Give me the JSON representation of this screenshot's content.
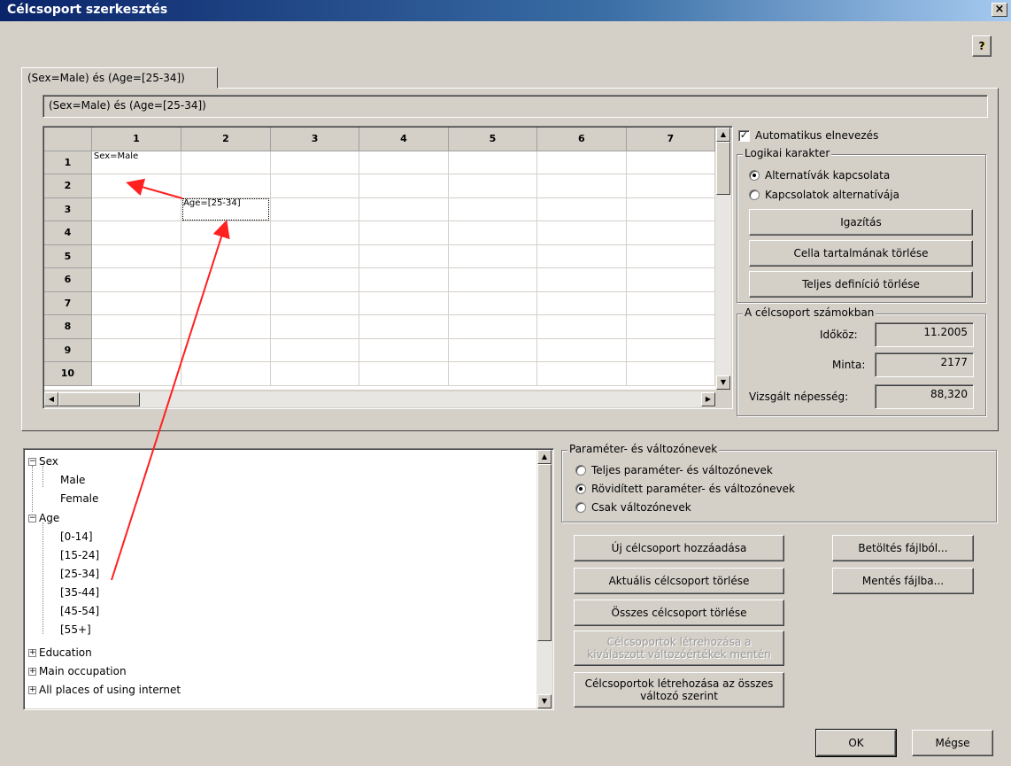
{
  "window": {
    "title": "Célcsoport szerkesztés",
    "close": "×",
    "help": "?"
  },
  "tab": {
    "label": "(Sex=Male) és (Age=[25-34])"
  },
  "expression": "(Sex=Male) és (Age=[25-34])",
  "grid": {
    "columns": [
      "1",
      "2",
      "3",
      "4",
      "5",
      "6",
      "7"
    ],
    "rows": [
      "1",
      "2",
      "3",
      "4",
      "5",
      "6",
      "7",
      "8",
      "9",
      "10"
    ],
    "cells": {
      "r1c1": "Sex=Male",
      "r3c2": "Age=[25-34]"
    }
  },
  "options": {
    "auto_naming": {
      "label": "Automatikus elnevezés",
      "checked": true
    },
    "logic": {
      "legend": "Logikai karakter",
      "opt1": "Alternatívák kapcsolata",
      "opt2": "Kapcsolatok alternatívája",
      "selected": 1
    },
    "align_button": "Igazítás",
    "clear_cell_button": "Cella tartalmának törlése",
    "clear_all_button": "Teljes definíció törlése"
  },
  "numbers": {
    "legend": "A célcsoport számokban",
    "period_label": "Időköz:",
    "period": "11.2005",
    "sample_label": "Minta:",
    "sample": "2177",
    "population_label": "Vizsgált népesség:",
    "population": "88,320"
  },
  "tree": {
    "sex": "Sex",
    "male": "Male",
    "female": "Female",
    "age": "Age",
    "ages": [
      "[0-14]",
      "[15-24]",
      "[25-34]",
      "[35-44]",
      "[45-54]",
      "[55+]"
    ],
    "education": "Education",
    "occupation": "Main occupation",
    "places": "All places of using internet"
  },
  "names": {
    "legend": "Paraméter- és változónevek",
    "opt1": "Teljes paraméter- és változónevek",
    "opt2": "Rövidített paraméter- és változónevek",
    "opt3": "Csak változónevek",
    "selected": 2
  },
  "actions": {
    "add": "Új célcsoport hozzáadása",
    "delete_current": "Aktuális célcsoport törlése",
    "delete_all": "Összes célcsoport törlése",
    "create_selected_1": "Célcsoportok létrehozása a",
    "create_selected_2": "kiválaszott változóértékek mentén",
    "create_all_1": "Célcsoportok létrehozása az összes",
    "create_all_2": "változó szerint",
    "load": "Betöltés fájlból...",
    "save": "Mentés fájlba..."
  },
  "footer": {
    "ok": "OK",
    "cancel": "Mégse"
  },
  "colors": {
    "titlebar": "#0a246a",
    "arrow": "#ff0000",
    "face": "#d4d0c8"
  }
}
